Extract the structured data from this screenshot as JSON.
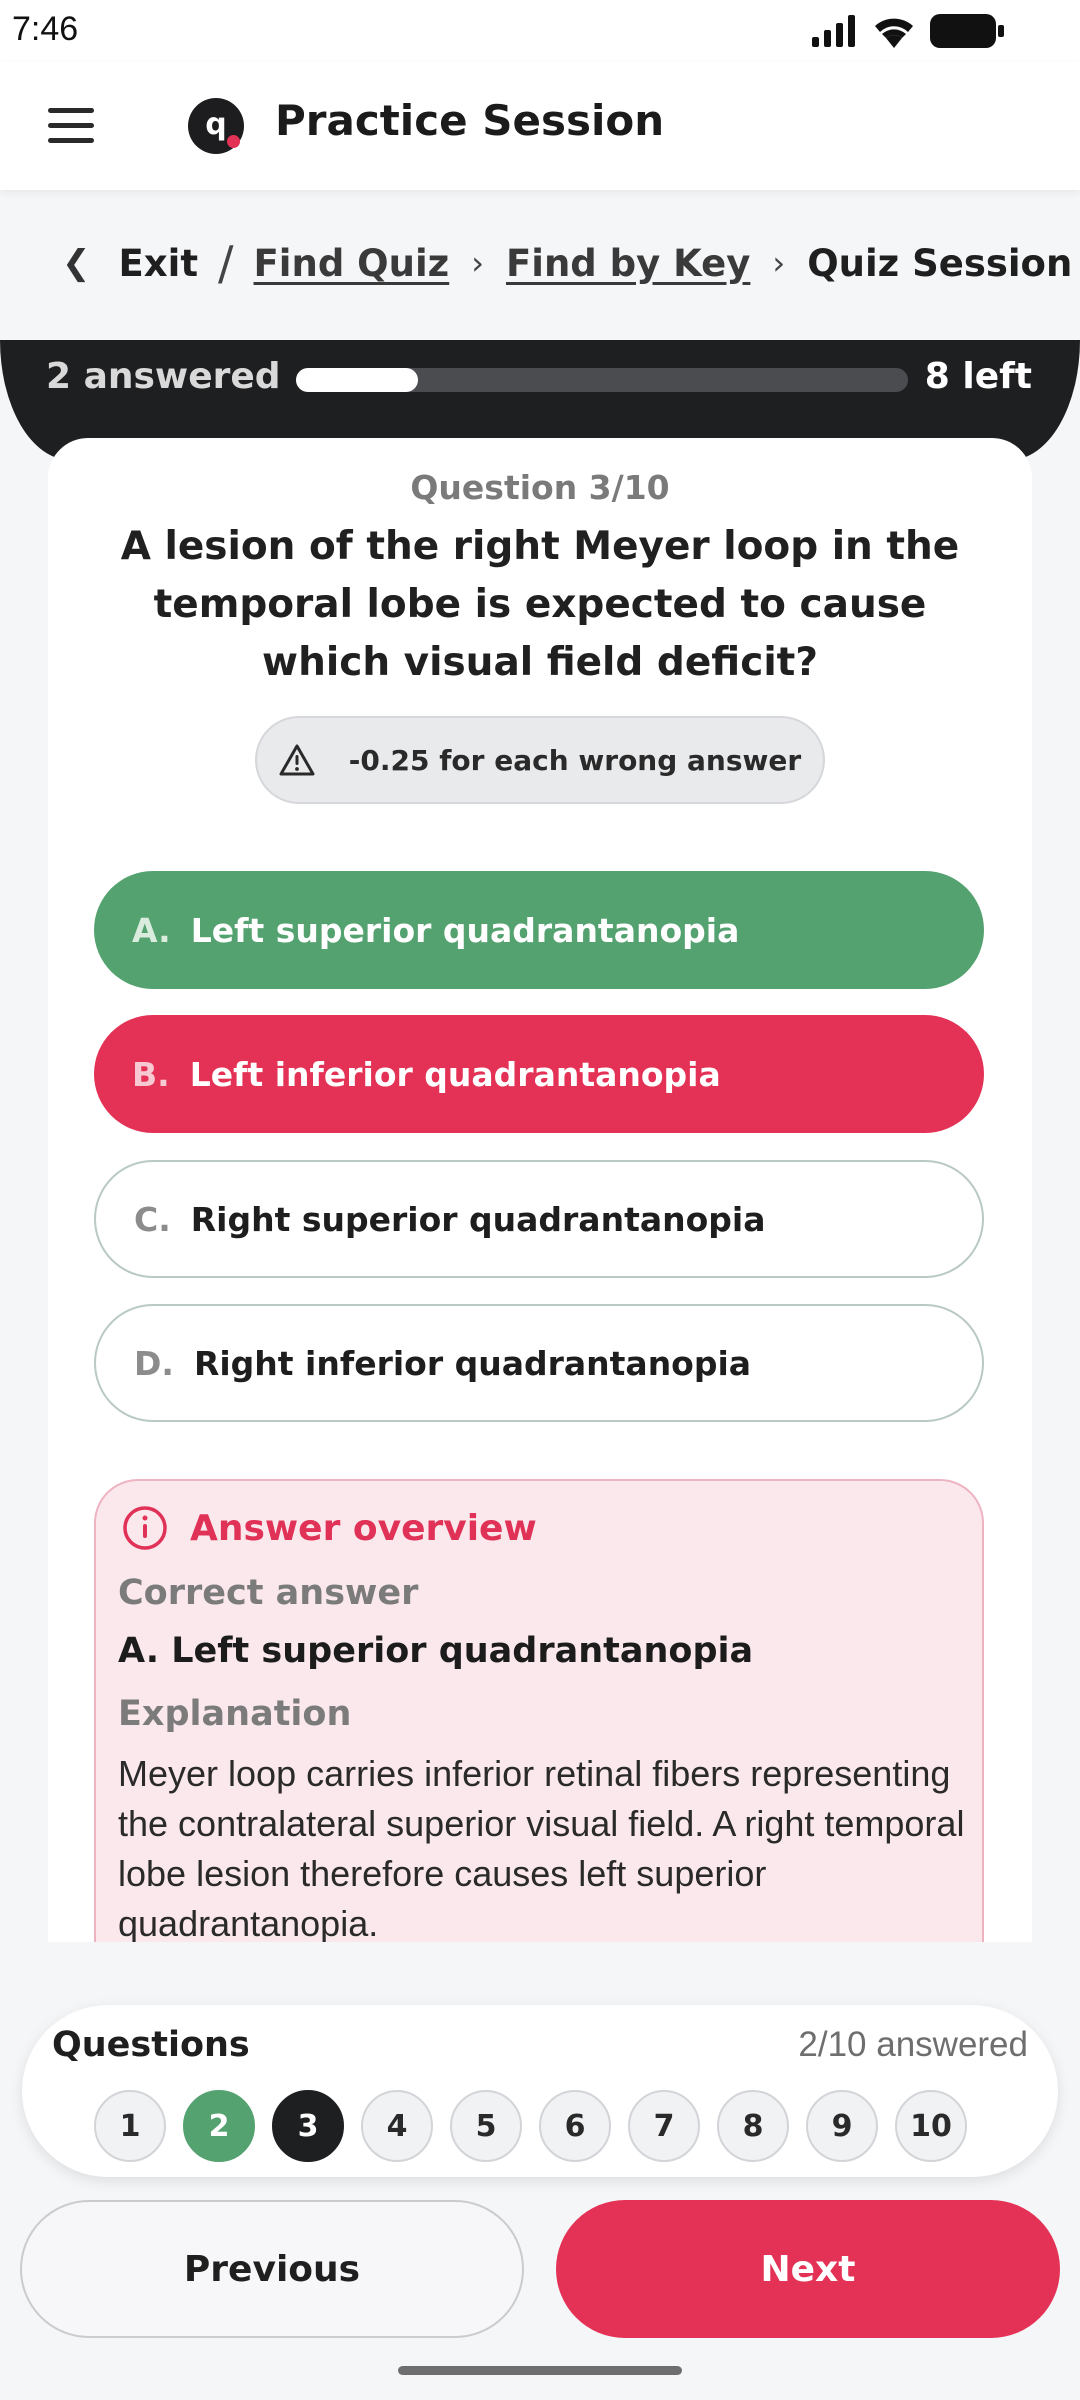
{
  "status_bar": {
    "time": "7:46"
  },
  "app_bar": {
    "title": "Practice Session",
    "logo_letter": "q"
  },
  "breadcrumb": {
    "exit": "Exit",
    "separator": "/",
    "items": [
      "Find Quiz",
      "Find by Key",
      "Quiz Session"
    ]
  },
  "progress": {
    "answered_label": "2 answered",
    "left_label": "8 left",
    "fraction": 0.2
  },
  "question": {
    "number_label": "Question 3/10",
    "text": "A lesion of the right Meyer loop in the temporal lobe is expected to cause which visual field deficit?",
    "penalty": "-0.25 for each wrong answer",
    "options": [
      {
        "letter": "A.",
        "text": "Left superior quadrantanopia",
        "state": "correct"
      },
      {
        "letter": "B.",
        "text": "Left inferior quadrantanopia",
        "state": "wrong"
      },
      {
        "letter": "C.",
        "text": "Right superior quadrantanopia",
        "state": "neutral"
      },
      {
        "letter": "D.",
        "text": "Right inferior quadrantanopia",
        "state": "neutral"
      }
    ]
  },
  "overview": {
    "title": "Answer overview",
    "correct_label": "Correct answer",
    "correct_answer": "A. Left superior quadrantanopia",
    "explanation_label": "Explanation",
    "explanation": "Meyer loop carries inferior retinal fibers representing the contralateral superior visual field. A right temporal lobe lesion therefore causes left superior quadrantanopia."
  },
  "navigator": {
    "title": "Questions",
    "count": "2/10 answered",
    "bubbles": [
      "1",
      "2",
      "3",
      "4",
      "5",
      "6",
      "7",
      "8",
      "9",
      "10"
    ],
    "answered_index": 1,
    "current_index": 2
  },
  "buttons": {
    "previous": "Previous",
    "next": "Next"
  },
  "colors": {
    "correct": "#55a271",
    "wrong": "#e43256",
    "dark": "#1e1f21",
    "accent": "#e03157"
  },
  "icons": [
    "menu-icon",
    "back-chevron-icon",
    "warning-icon",
    "info-icon",
    "signal-icon",
    "wifi-icon",
    "battery-icon"
  ]
}
